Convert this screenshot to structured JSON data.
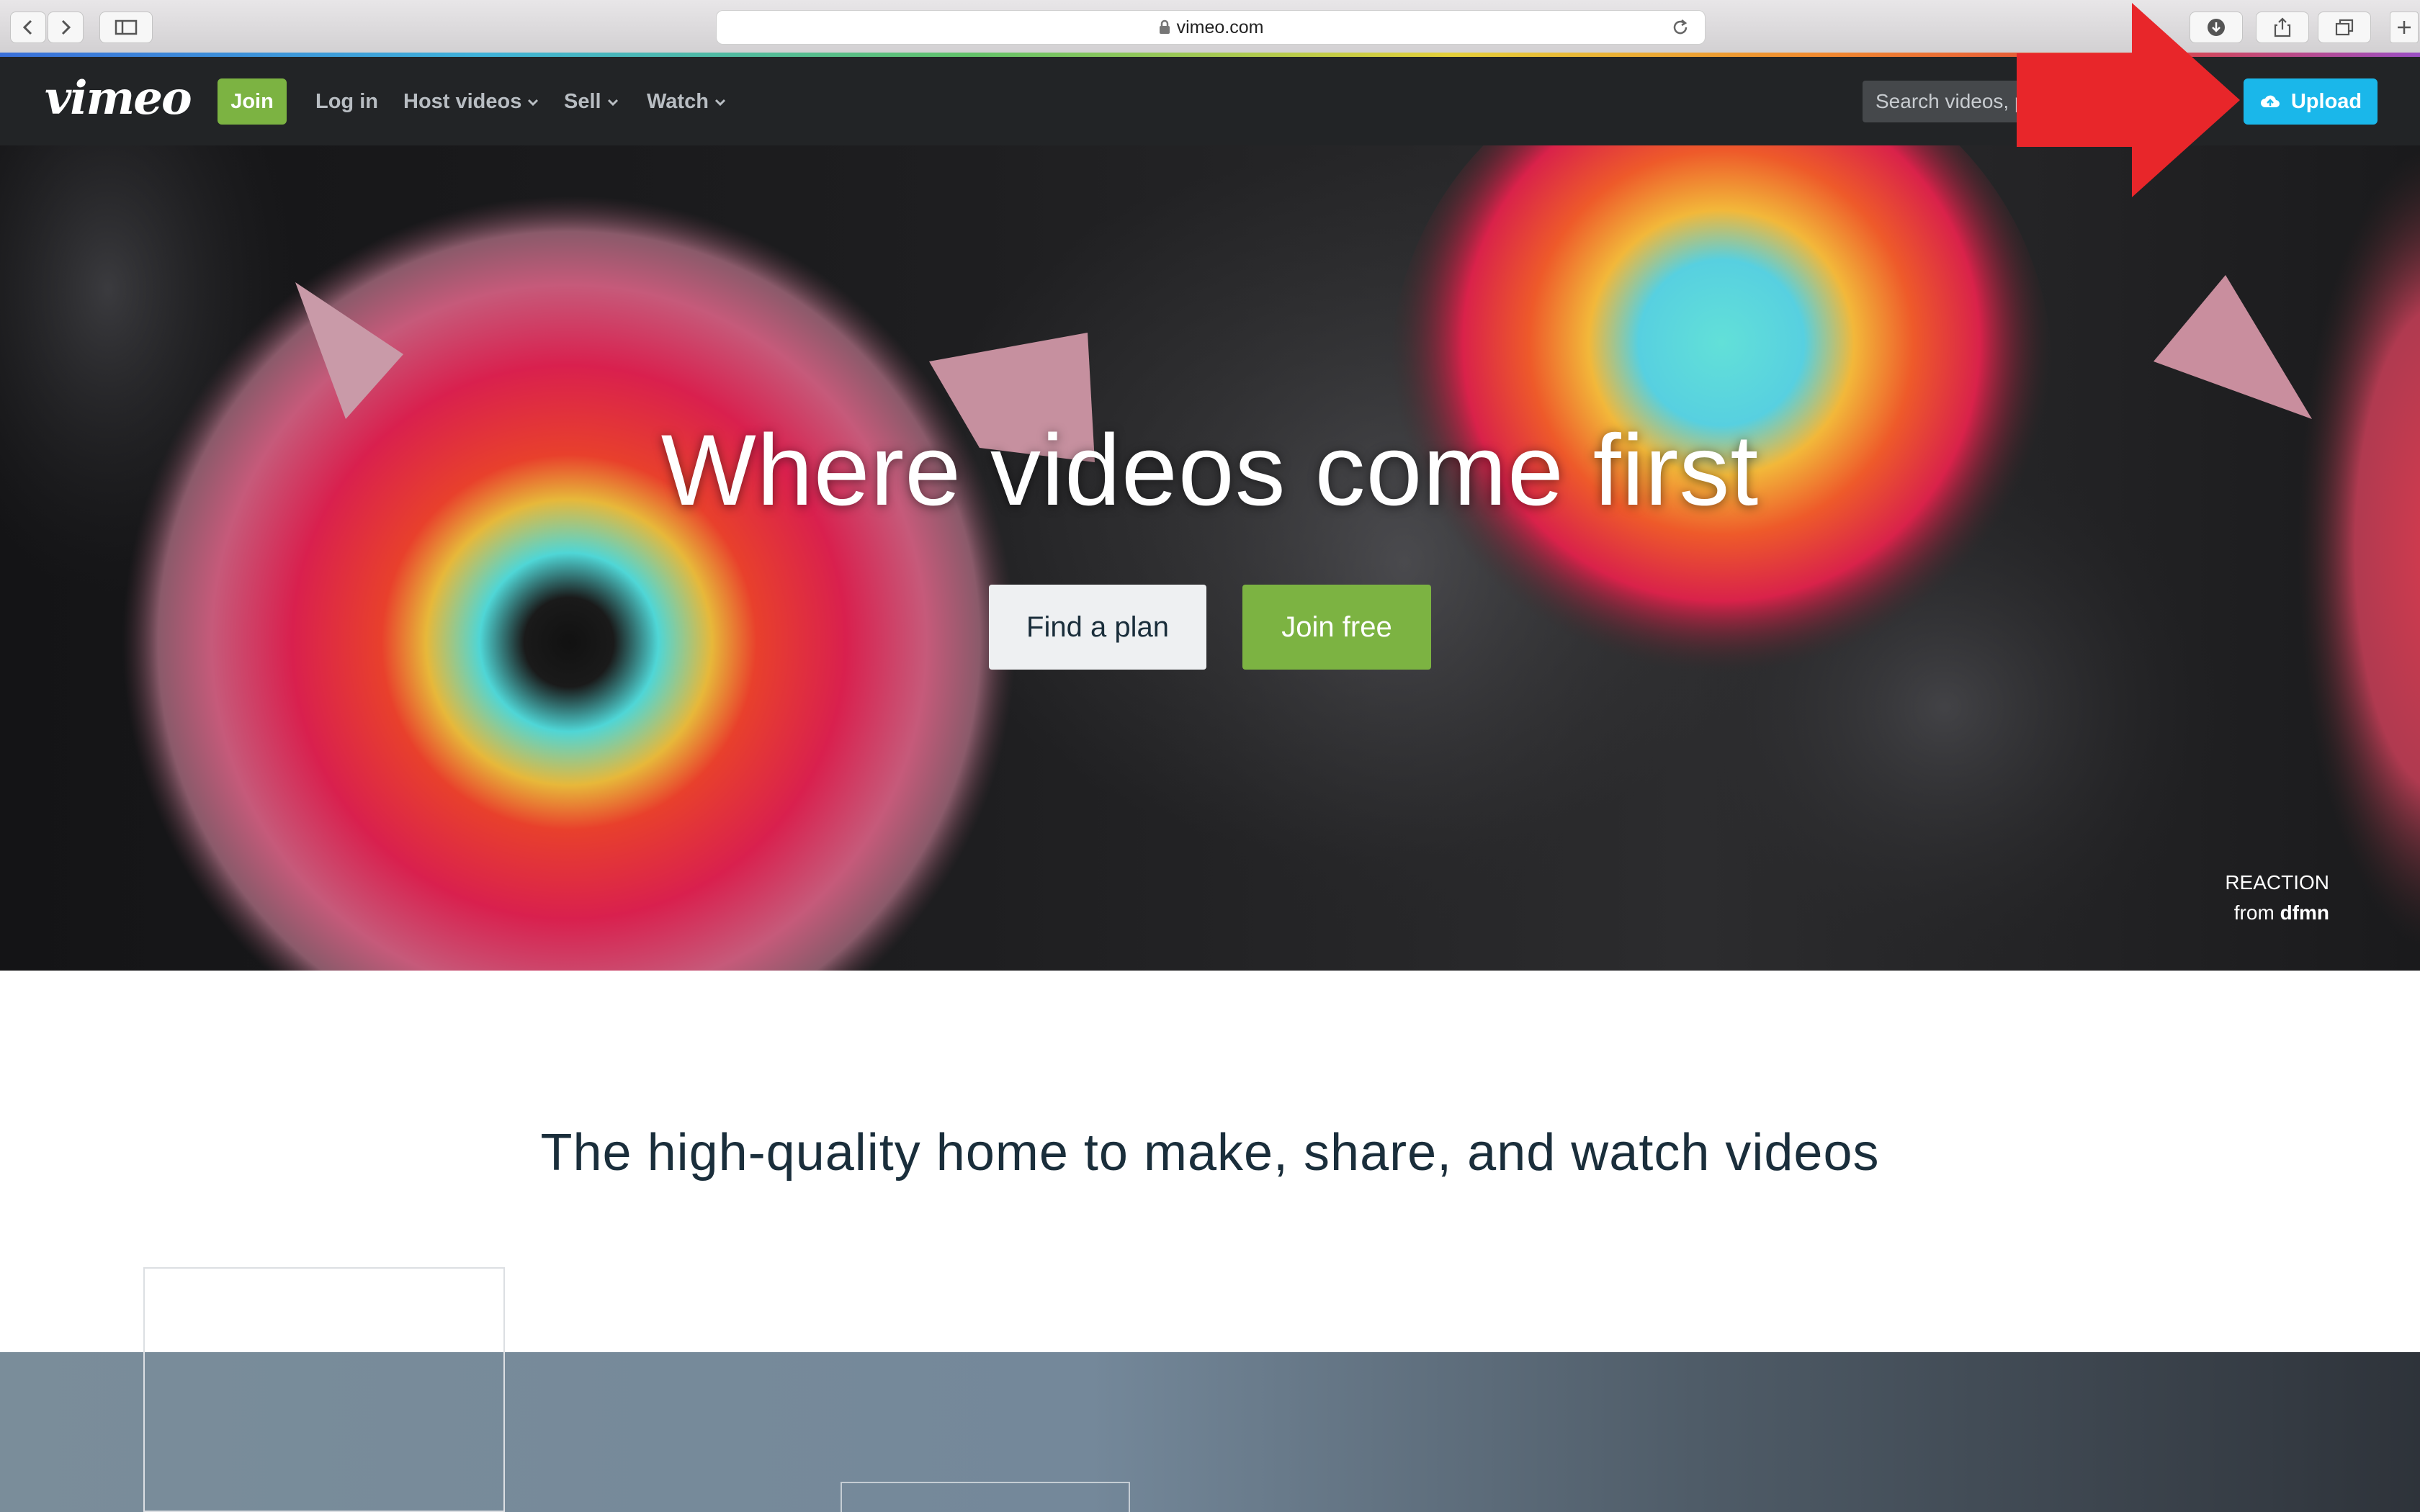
{
  "browser": {
    "url": "vimeo.com",
    "icons": [
      "back-icon",
      "forward-icon",
      "sidebar-icon",
      "lock-icon",
      "reload-icon",
      "download-icon",
      "share-icon",
      "tabs-icon",
      "new-tab-icon"
    ]
  },
  "nav": {
    "logo": "vimeo",
    "join": "Join",
    "login": "Log in",
    "host_videos": "Host videos",
    "sell": "Sell",
    "watch": "Watch",
    "search_placeholder": "Search videos, p",
    "upload": "Upload"
  },
  "hero": {
    "title": "Where videos come first",
    "find_plan": "Find a plan",
    "join_free": "Join free",
    "credit_title": "REACTION",
    "credit_from": "from",
    "credit_author": "dfmn"
  },
  "tagline": "The high-quality home to make, share, and watch videos",
  "colors": {
    "nav_bg": "#222426",
    "join_green": "#7cb342",
    "upload_blue": "#1ab7ea",
    "annotation_red": "#e8262a",
    "heading_navy": "#1a2e3b"
  }
}
